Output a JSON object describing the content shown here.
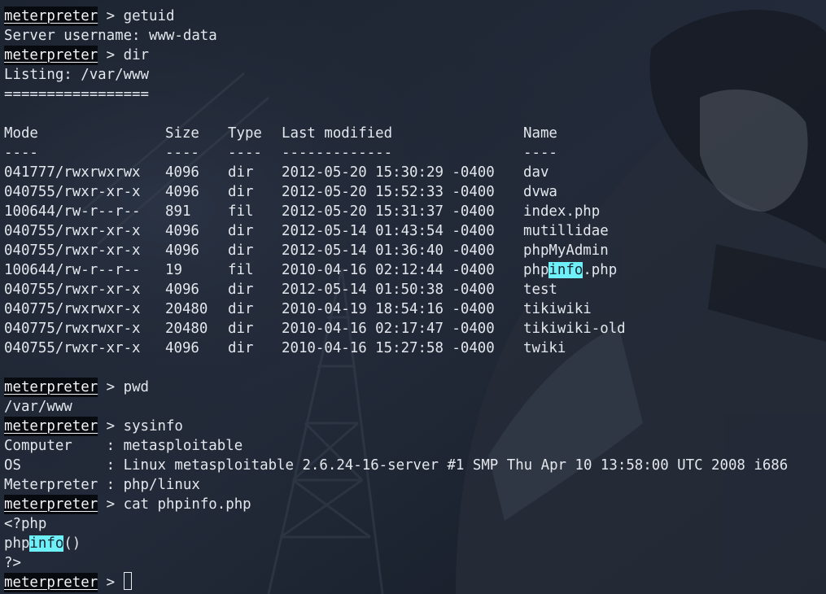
{
  "prompt": "meterpreter",
  "prompt_sep": " > ",
  "cmd_getuid": "getuid",
  "getuid_output": "Server username: www-data",
  "cmd_dir": "dir",
  "dir_listing_title": "Listing: /var/www",
  "dir_listing_rule": "=================",
  "dir_table": {
    "headers": [
      "Mode",
      "Size",
      "Type",
      "Last modified",
      "Name"
    ],
    "underlines": [
      "----",
      "----",
      "----",
      "-------------",
      "----"
    ],
    "rows": [
      [
        "041777/rwxrwxrwx",
        "4096",
        "dir",
        "2012-05-20 15:30:29 -0400",
        "dav"
      ],
      [
        "040755/rwxr-xr-x",
        "4096",
        "dir",
        "2012-05-20 15:52:33 -0400",
        "dvwa"
      ],
      [
        "100644/rw-r--r--",
        "891",
        "fil",
        "2012-05-20 15:31:37 -0400",
        "index.php"
      ],
      [
        "040755/rwxr-xr-x",
        "4096",
        "dir",
        "2012-05-14 01:43:54 -0400",
        "mutillidae"
      ],
      [
        "040755/rwxr-xr-x",
        "4096",
        "dir",
        "2012-05-14 01:36:40 -0400",
        "phpMyAdmin"
      ],
      [
        "100644/rw-r--r--",
        "19",
        "fil",
        "2010-04-16 02:12:44 -0400",
        "phpinfo.php"
      ],
      [
        "040755/rwxr-xr-x",
        "4096",
        "dir",
        "2012-05-14 01:50:38 -0400",
        "test"
      ],
      [
        "040775/rwxrwxr-x",
        "20480",
        "dir",
        "2010-04-19 18:54:16 -0400",
        "tikiwiki"
      ],
      [
        "040775/rwxrwxr-x",
        "20480",
        "dir",
        "2010-04-16 02:17:47 -0400",
        "tikiwiki-old"
      ],
      [
        "040755/rwxr-xr-x",
        "4096",
        "dir",
        "2010-04-16 15:27:58 -0400",
        "twiki"
      ]
    ],
    "phpinfo_name_parts": [
      "php",
      "info",
      ".php"
    ]
  },
  "cmd_pwd": "pwd",
  "pwd_output": "/var/www",
  "cmd_sysinfo": "sysinfo",
  "sysinfo": {
    "computer": "Computer    : metasploitable",
    "os": "OS          : Linux metasploitable 2.6.24-16-server #1 SMP Thu Apr 10 13:58:00 UTC 2008 i686",
    "meterpreter": "Meterpreter : php/linux"
  },
  "cmd_cat": "cat phpinfo.php",
  "cat_output": {
    "line1": "<?php",
    "line2_parts": [
      "php",
      "info",
      "()"
    ],
    "line3": "?>"
  },
  "highlight_color": "#6ef0f8",
  "background_color": "#1e2533"
}
